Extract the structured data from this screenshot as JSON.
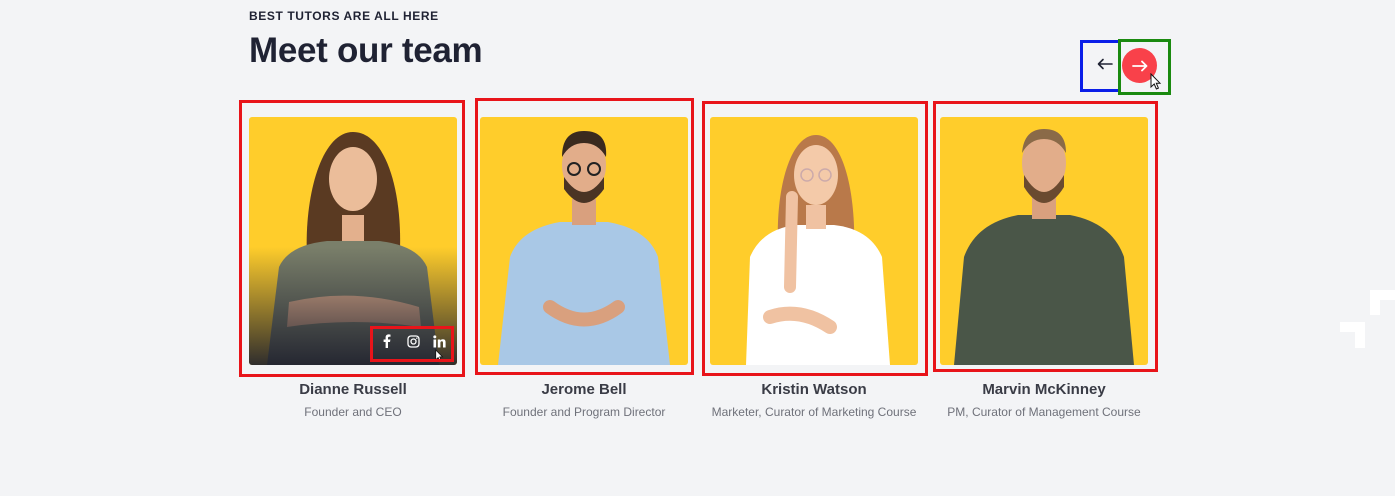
{
  "section": {
    "eyebrow": "BEST TUTORS ARE ALL HERE",
    "title": "Meet our team"
  },
  "nav": {
    "prev_icon": "arrow-left-icon",
    "next_icon": "arrow-right-icon",
    "next_color": "#f9414a"
  },
  "team": [
    {
      "name": "Dianne Russell",
      "role": "Founder and CEO",
      "shirt": "#7a7f6a",
      "hair": "#5a3a22"
    },
    {
      "name": "Jerome Bell",
      "role": "Founder and Program Director",
      "shirt": "#a9c8e6",
      "hair": "#3a2a1e"
    },
    {
      "name": "Kristin Watson",
      "role": "Marketer, Curator of Marketing Course",
      "shirt": "#ffffff",
      "hair": "#b9794a"
    },
    {
      "name": "Marvin McKinney",
      "role": "PM, Curator of Management Course",
      "shirt": "#4a5648",
      "hair": "#8a6a48"
    }
  ],
  "socials": [
    "facebook-icon",
    "instagram-icon",
    "linkedin-icon"
  ],
  "colors": {
    "card_bg": "#ffcd2b",
    "page_bg": "#f3f4f6",
    "accent": "#f9414a"
  }
}
